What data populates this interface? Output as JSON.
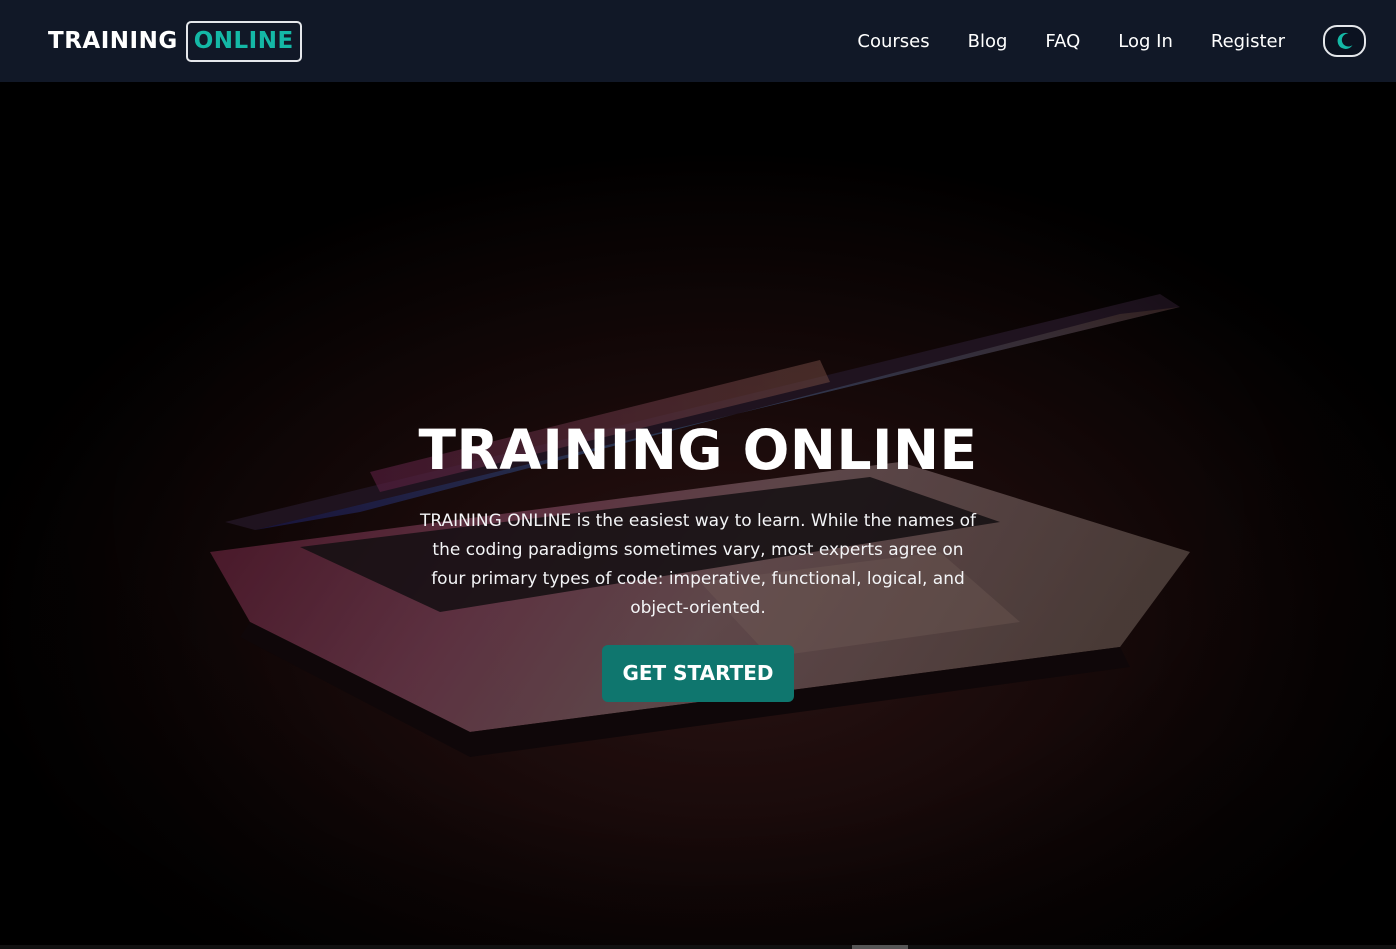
{
  "header": {
    "logo_primary": "TRAINING",
    "logo_accent": "ONLINE",
    "nav": [
      "Courses",
      "Blog",
      "FAQ",
      "Log In",
      "Register"
    ],
    "theme_toggle_icon": "moon-icon"
  },
  "hero": {
    "title": "TRAINING ONLINE",
    "description": "TRAINING ONLINE is the easiest way to learn. While the names of the coding paradigms sometimes vary, most experts agree on four primary types of code: imperative, functional, logical, and object-oriented.",
    "cta_label": "GET STARTED"
  },
  "colors": {
    "navbar_bg": "#111827",
    "accent": "#14b8a6",
    "cta_bg": "#0f766e"
  }
}
